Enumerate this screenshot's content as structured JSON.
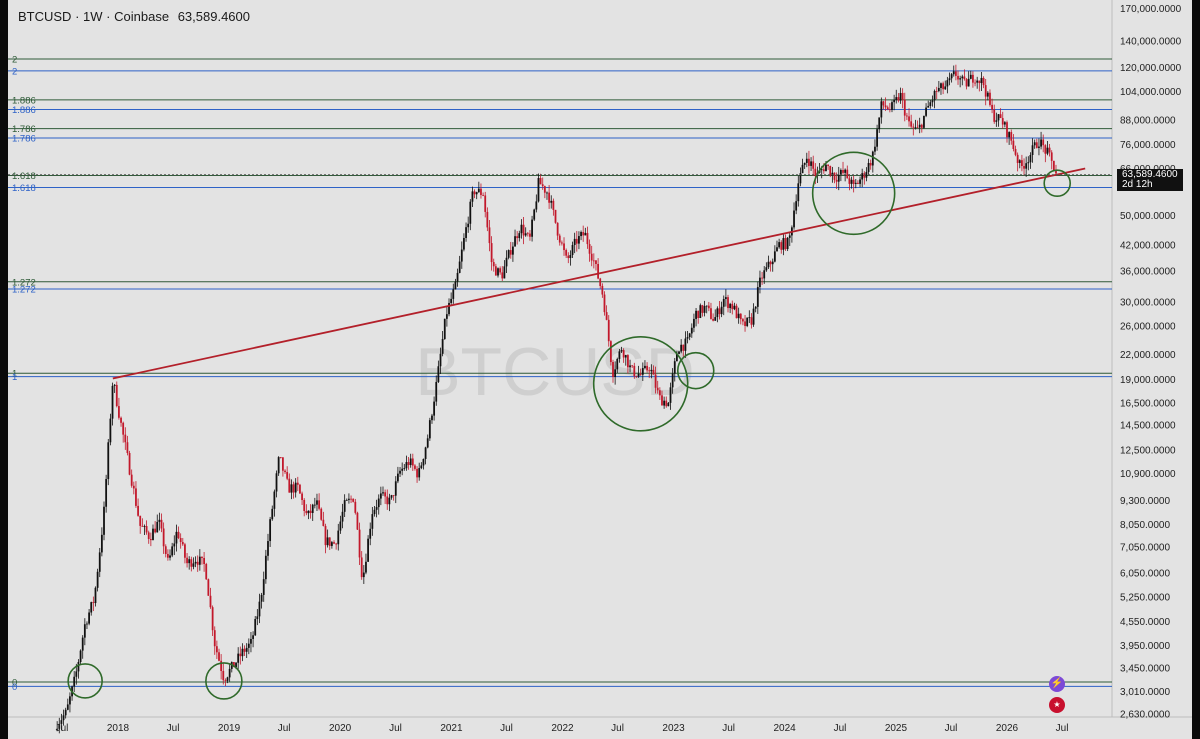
{
  "header": {
    "symbol": "BTCUSD",
    "interval": "1W",
    "exchange": "Coinbase",
    "price": "63,589.4600",
    "separator": "·"
  },
  "watermark": "BTCUSD",
  "price_tag": {
    "price": "63,589.4600",
    "countdown": "2d 12h"
  },
  "icons": {
    "lightning": "lightning-icon",
    "flag": "us-flag-icon"
  },
  "colors": {
    "background": "#e3e3e3",
    "up_candle": "#111111",
    "down_candle": "#c2182b",
    "trend_line": "#b3202a",
    "circle": "#2f6a2a",
    "fib_green": "#2f5b38",
    "fib_blue": "#2e62c7"
  },
  "chart_data": {
    "type": "candlestick",
    "scale": "log",
    "ylim": [
      2400,
      175000
    ],
    "y_ticks": [
      "170,000.0000",
      "140,000.0000",
      "120,000.0000",
      "104,000.0000",
      "88,000.0000",
      "76,000.0000",
      "66,000.0000",
      "50,000.0000",
      "42,000.0000",
      "36,000.0000",
      "30,000.0000",
      "26,000.0000",
      "22,000.0000",
      "19,000.0000",
      "16,500.0000",
      "14,500.0000",
      "12,500.0000",
      "10,900.0000",
      "9,300.0000",
      "8,050.0000",
      "7,050.0000",
      "6,050.0000",
      "5,250.0000",
      "4,550.0000",
      "3,950.0000",
      "3,450.0000",
      "3,010.0000",
      "2,630.0000"
    ],
    "x_ticks": [
      "Jul",
      "2018",
      "Jul",
      "2019",
      "Jul",
      "2020",
      "Jul",
      "2021",
      "Jul",
      "2022",
      "Jul",
      "2023",
      "Jul",
      "2024",
      "Jul",
      "2025",
      "Jul",
      "2026",
      "Jul"
    ],
    "price_path": [
      [
        "2017-06",
        2500
      ],
      [
        "2017-07",
        2650
      ],
      [
        "2017-08",
        3300
      ],
      [
        "2017-09",
        4500
      ],
      [
        "2017-10",
        5200
      ],
      [
        "2017-11",
        8500
      ],
      [
        "2017-12",
        19000
      ],
      [
        "2018-01",
        14000
      ],
      [
        "2018-02",
        10500
      ],
      [
        "2018-03",
        8000
      ],
      [
        "2018-04",
        7500
      ],
      [
        "2018-05",
        8200
      ],
      [
        "2018-06",
        6400
      ],
      [
        "2018-07",
        7800
      ],
      [
        "2018-08",
        6400
      ],
      [
        "2018-09",
        6600
      ],
      [
        "2018-10",
        6300
      ],
      [
        "2018-11",
        4000
      ],
      [
        "2018-12",
        3250
      ],
      [
        "2019-01",
        3500
      ],
      [
        "2019-02",
        3800
      ],
      [
        "2019-03",
        4000
      ],
      [
        "2019-04",
        5200
      ],
      [
        "2019-05",
        8000
      ],
      [
        "2019-06",
        12000
      ],
      [
        "2019-07",
        10000
      ],
      [
        "2019-08",
        10000
      ],
      [
        "2019-09",
        8400
      ],
      [
        "2019-10",
        9200
      ],
      [
        "2019-11",
        7300
      ],
      [
        "2019-12",
        7200
      ],
      [
        "2020-01",
        9000
      ],
      [
        "2020-02",
        9500
      ],
      [
        "2020-03",
        5800
      ],
      [
        "2020-04",
        8700
      ],
      [
        "2020-05",
        9500
      ],
      [
        "2020-06",
        9200
      ],
      [
        "2020-07",
        11000
      ],
      [
        "2020-08",
        11700
      ],
      [
        "2020-09",
        10800
      ],
      [
        "2020-10",
        13500
      ],
      [
        "2020-11",
        19000
      ],
      [
        "2020-12",
        28000
      ],
      [
        "2021-01",
        33000
      ],
      [
        "2021-02",
        45000
      ],
      [
        "2021-03",
        58000
      ],
      [
        "2021-04",
        57000
      ],
      [
        "2021-05",
        37000
      ],
      [
        "2021-06",
        35000
      ],
      [
        "2021-07",
        41000
      ],
      [
        "2021-08",
        47000
      ],
      [
        "2021-09",
        43000
      ],
      [
        "2021-10",
        61000
      ],
      [
        "2021-11",
        57000
      ],
      [
        "2021-12",
        46000
      ],
      [
        "2022-01",
        38000
      ],
      [
        "2022-02",
        43000
      ],
      [
        "2022-03",
        45000
      ],
      [
        "2022-04",
        38000
      ],
      [
        "2022-05",
        31000
      ],
      [
        "2022-06",
        19800
      ],
      [
        "2022-07",
        23000
      ],
      [
        "2022-08",
        20000
      ],
      [
        "2022-09",
        19500
      ],
      [
        "2022-10",
        20500
      ],
      [
        "2022-11",
        17000
      ],
      [
        "2022-12",
        16500
      ],
      [
        "2023-01",
        23000
      ],
      [
        "2023-02",
        23500
      ],
      [
        "2023-03",
        28000
      ],
      [
        "2023-04",
        29000
      ],
      [
        "2023-05",
        27000
      ],
      [
        "2023-06",
        30500
      ],
      [
        "2023-07",
        29200
      ],
      [
        "2023-08",
        26000
      ],
      [
        "2023-09",
        27000
      ],
      [
        "2023-10",
        34500
      ],
      [
        "2023-11",
        37700
      ],
      [
        "2023-12",
        42200
      ],
      [
        "2024-01",
        42500
      ],
      [
        "2024-02",
        61000
      ],
      [
        "2024-03",
        71000
      ],
      [
        "2024-04",
        63000
      ],
      [
        "2024-05",
        67500
      ],
      [
        "2024-06",
        62700
      ],
      [
        "2024-07",
        64500
      ],
      [
        "2024-08",
        59000
      ],
      [
        "2024-09",
        63300
      ],
      [
        "2024-10",
        70200
      ],
      [
        "2024-11",
        96400
      ],
      [
        "2024-12",
        93400
      ],
      [
        "2025-01",
        102000
      ],
      [
        "2025-02",
        84300
      ],
      [
        "2025-03",
        82500
      ],
      [
        "2025-04",
        94200
      ],
      [
        "2025-05",
        104600
      ],
      [
        "2025-06",
        107100
      ],
      [
        "2025-07",
        115700
      ],
      [
        "2025-08",
        108200
      ],
      [
        "2025-09",
        114000
      ],
      [
        "2025-10",
        109500
      ],
      [
        "2025-11",
        90400
      ],
      [
        "2025-12",
        87500
      ],
      [
        "2026-01",
        78000
      ],
      [
        "2026-02",
        66000
      ],
      [
        "2026-03",
        71000
      ],
      [
        "2026-04",
        78000
      ],
      [
        "2026-05",
        72000
      ],
      [
        "2026-06",
        63589
      ]
    ],
    "fib_levels": [
      {
        "label": "2",
        "price": 126000,
        "color": "green"
      },
      {
        "label": "2",
        "price": 117500,
        "color": "blue"
      },
      {
        "label": "1.886",
        "price": 99000,
        "color": "green"
      },
      {
        "label": "1.886",
        "price": 93500,
        "color": "blue"
      },
      {
        "label": "1.786",
        "price": 83500,
        "color": "green"
      },
      {
        "label": "1.786",
        "price": 79000,
        "color": "blue"
      },
      {
        "label": "1.618",
        "price": 63300,
        "color": "green"
      },
      {
        "label": "1.618",
        "price": 59000,
        "color": "blue"
      },
      {
        "label": "1.272",
        "price": 33800,
        "color": "green"
      },
      {
        "label": "1.272",
        "price": 32400,
        "color": "blue"
      },
      {
        "label": "1",
        "price": 19700,
        "color": "green"
      },
      {
        "label": "1",
        "price": 19300,
        "color": "blue"
      },
      {
        "label": "0",
        "price": 3180,
        "color": "green"
      },
      {
        "label": "0",
        "price": 3100,
        "color": "blue"
      }
    ],
    "trend_line": [
      [
        "2017-12",
        19100
      ],
      [
        "2026-09",
        66000
      ]
    ],
    "circles": [
      {
        "date": "2017-09",
        "price": 3200
      },
      {
        "date": "2018-12",
        "price": 3200
      },
      {
        "date": "2022-09",
        "price": 18500
      },
      {
        "date": "2023-03",
        "price": 20000
      },
      {
        "date": "2024-08",
        "price": 57000
      },
      {
        "date": "2026-06",
        "price": 60500
      }
    ]
  }
}
